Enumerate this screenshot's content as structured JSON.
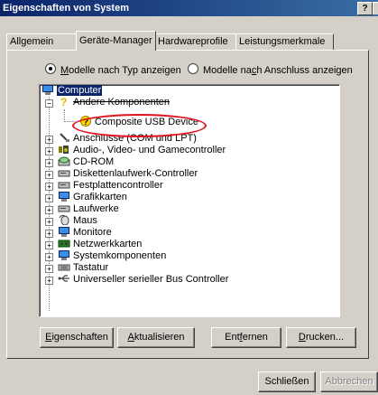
{
  "window": {
    "title": "Eigenschaften von System",
    "help_label": "?"
  },
  "tabs": [
    {
      "label": "Allgemein"
    },
    {
      "label": "Geräte-Manager"
    },
    {
      "label": "Hardwareprofile"
    },
    {
      "label": "Leistungsmerkmale"
    }
  ],
  "view_options": {
    "by_type": {
      "pre": "",
      "accel": "M",
      "post": "odelle nach Typ anzeigen",
      "checked": true
    },
    "by_connection": {
      "pre": "Modelle na",
      "accel": "c",
      "post": "h Anschluss anzeigen",
      "checked": false
    }
  },
  "tree": {
    "root": "Computer",
    "other_devices": "Andere Komponenten",
    "highlighted_device": "Composite USB Device",
    "items": [
      "Anschlüsse (COM und LPT)",
      "Audio-, Video- und Gamecontroller",
      "CD-ROM",
      "Diskettenlaufwerk-Controller",
      "Festplattencontroller",
      "Grafikkarten",
      "Laufwerke",
      "Maus",
      "Monitore",
      "Netzwerkkarten",
      "Systemkomponenten",
      "Tastatur",
      "Universeller serieller Bus Controller"
    ],
    "highlight_color": "#e0101e"
  },
  "actions": {
    "properties": {
      "accel": "E",
      "post": "igenschaften"
    },
    "refresh": {
      "accel": "A",
      "post": "ktualisieren"
    },
    "remove": {
      "pre": "Ent",
      "accel": "f",
      "post": "ernen"
    },
    "print": {
      "accel": "D",
      "post": "rucken..."
    }
  },
  "footer": {
    "close": "Schließen",
    "cancel": "Abbrechen"
  },
  "colors": {
    "title_gradient_start": "#0a246a",
    "title_gradient_end": "#3a6ea5",
    "face": "#d4d0c8",
    "selection": "#0a246a"
  }
}
